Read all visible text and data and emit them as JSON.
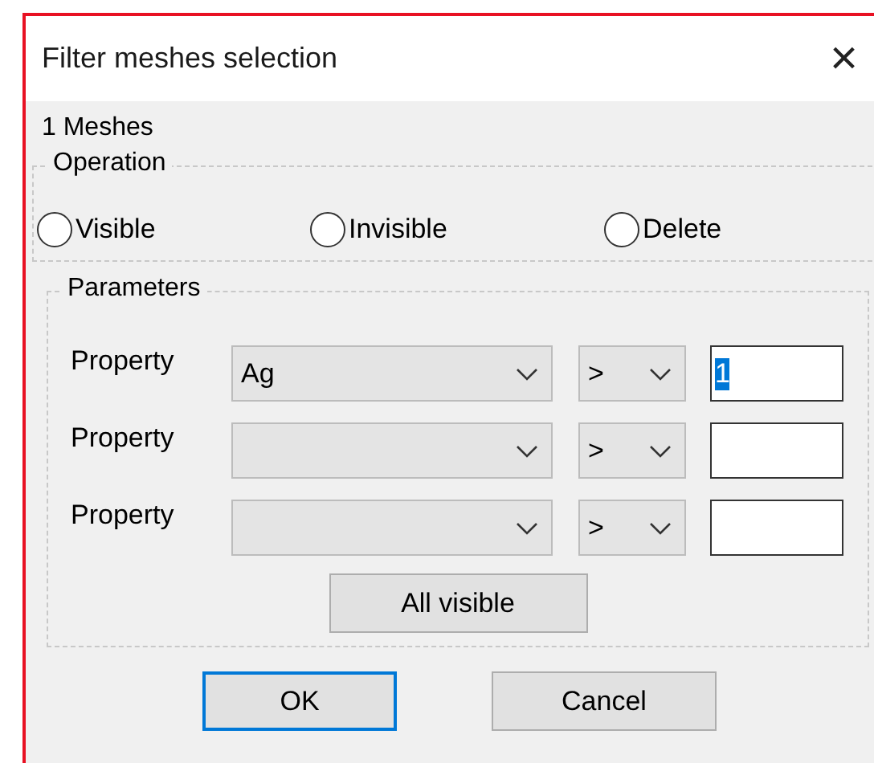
{
  "window": {
    "title": "Filter meshes selection",
    "close": "×"
  },
  "count_label": "1 Meshes",
  "operation": {
    "title": "Operation",
    "options": [
      {
        "label": "Visible",
        "selected": false
      },
      {
        "label": "Invisible",
        "selected": false
      },
      {
        "label": "Delete",
        "selected": false
      }
    ]
  },
  "parameters": {
    "title": "Parameters",
    "rows": [
      {
        "label": "Property",
        "property": "Ag",
        "operator": ">",
        "value": "1",
        "value_selected": true
      },
      {
        "label": "Property",
        "property": "",
        "operator": ">",
        "value": ""
      },
      {
        "label": "Property",
        "property": "",
        "operator": ">",
        "value": ""
      }
    ],
    "all_visible": "All visible"
  },
  "buttons": [
    {
      "label": "OK",
      "default": true
    },
    {
      "label": "Cancel",
      "default": false
    }
  ]
}
